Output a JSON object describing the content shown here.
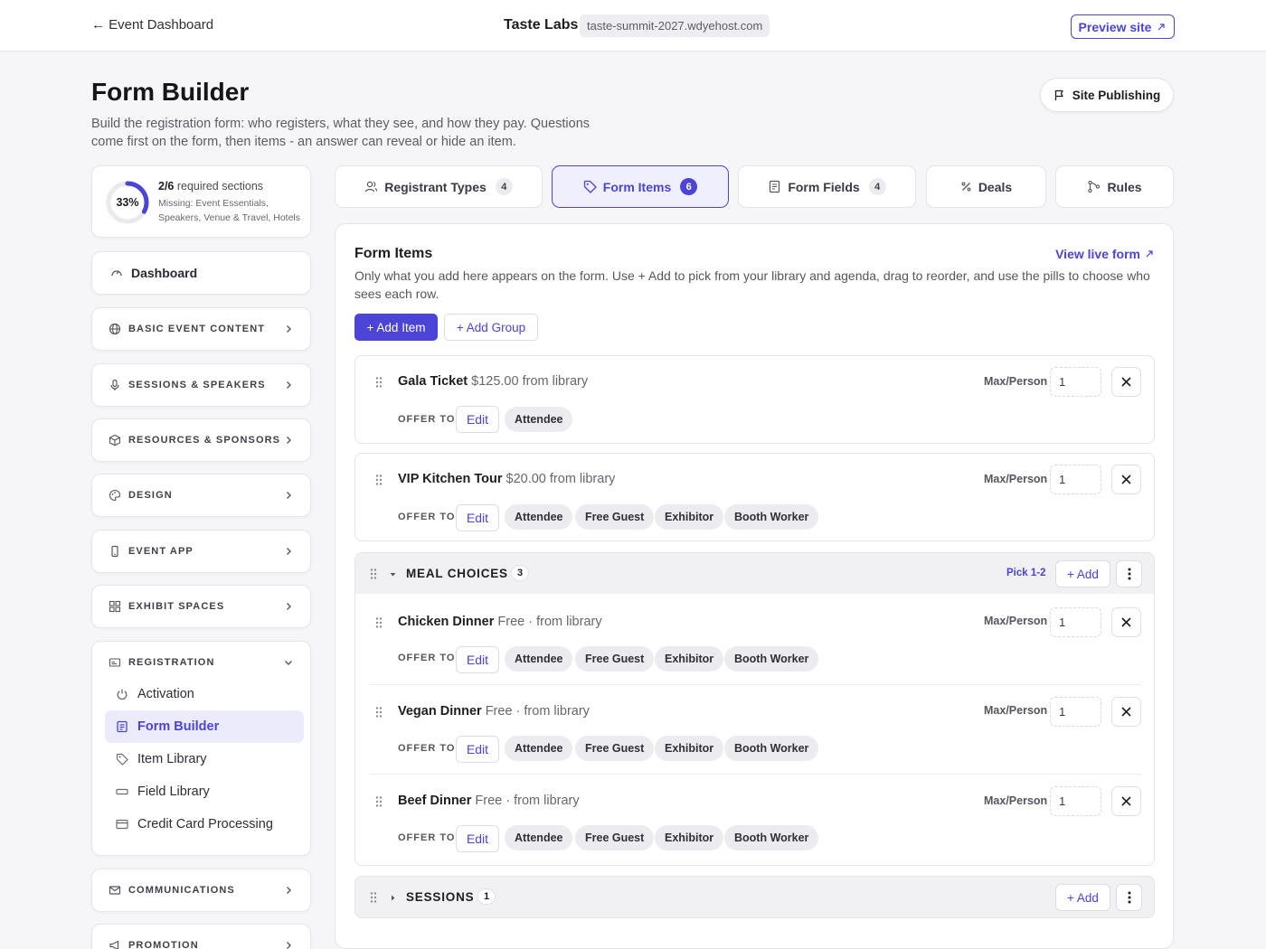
{
  "topbar": {
    "back_label": "← Event Dashboard",
    "org": "Taste Labs",
    "domain": "taste-summit-2027.wdyehost.com",
    "preview_label": "Preview site"
  },
  "page": {
    "title": "Form Builder",
    "subtitle": "Build the registration form: who registers, what they see, and how they pay. Questions come first on the form, then items - an answer can reveal or hide an item.",
    "publish_label": "Site Publishing"
  },
  "progress": {
    "percent_label": "33%",
    "fraction": 0.33,
    "done": "2/6",
    "req_suffix": " required sections",
    "missing": "Missing: Event Essentials, Speakers, Venue & Travel, Hotels"
  },
  "sidebar": {
    "dashboard": "Dashboard",
    "sections": [
      {
        "label": "BASIC EVENT CONTENT",
        "icon": "globe-icon"
      },
      {
        "label": "SESSIONS & SPEAKERS",
        "icon": "microphone-icon"
      },
      {
        "label": "RESOURCES & SPONSORS",
        "icon": "box-icon"
      },
      {
        "label": "DESIGN",
        "icon": "palette-icon"
      },
      {
        "label": "EVENT APP",
        "icon": "phone-icon"
      },
      {
        "label": "EXHIBIT SPACES",
        "icon": "grid-icon"
      }
    ],
    "registration": {
      "label": "REGISTRATION",
      "items": [
        "Activation",
        "Form Builder",
        "Item Library",
        "Field Library",
        "Credit Card Processing"
      ]
    },
    "after": [
      {
        "label": "COMMUNICATIONS",
        "icon": "mail-icon"
      },
      {
        "label": "PROMOTION",
        "icon": "megaphone-icon"
      }
    ]
  },
  "tabs": [
    {
      "label": "Registrant Types",
      "count": "4",
      "icon": "users-icon"
    },
    {
      "label": "Form Items",
      "count": "6",
      "icon": "tag-icon"
    },
    {
      "label": "Form Fields",
      "count": "4",
      "icon": "document-icon"
    },
    {
      "label": "Deals",
      "count": "",
      "icon": "percent-icon"
    },
    {
      "label": "Rules",
      "count": "",
      "icon": "branch-icon"
    }
  ],
  "panel": {
    "title": "Form Items",
    "view_live": "View live form",
    "description": "Only what you add here appears on the form. Use + Add to pick from your library and agenda, drag to reorder, and use the pills to choose who sees each row.",
    "add_item": "+ Add Item",
    "add_group": "+ Add Group",
    "max_label": "Max/Person",
    "offer_label": "OFFER TO",
    "edit_label": "Edit",
    "items": [
      {
        "name": "Gala Ticket",
        "meta": "$125.00 from library",
        "qty": "1",
        "offer": [
          "Attendee"
        ]
      },
      {
        "name": "VIP Kitchen Tour",
        "meta": "$20.00 from library",
        "qty": "1",
        "offer": [
          "Attendee",
          "Free Guest",
          "Exhibitor",
          "Booth Worker"
        ]
      }
    ],
    "group": {
      "title": "MEAL CHOICES",
      "count": "3",
      "pick": "Pick 1-2",
      "add": "+ Add",
      "items": [
        {
          "name": "Chicken Dinner",
          "meta": "Free · from library",
          "qty": "1",
          "offer": [
            "Attendee",
            "Free Guest",
            "Exhibitor",
            "Booth Worker"
          ]
        },
        {
          "name": "Vegan Dinner",
          "meta": "Free · from library",
          "qty": "1",
          "offer": [
            "Attendee",
            "Free Guest",
            "Exhibitor",
            "Booth Worker"
          ]
        },
        {
          "name": "Beef Dinner",
          "meta": "Free · from library",
          "qty": "1",
          "offer": [
            "Attendee",
            "Free Guest",
            "Exhibitor",
            "Booth Worker"
          ]
        }
      ]
    },
    "group2": {
      "title": "SESSIONS",
      "count": "1",
      "add": "+ Add"
    }
  }
}
